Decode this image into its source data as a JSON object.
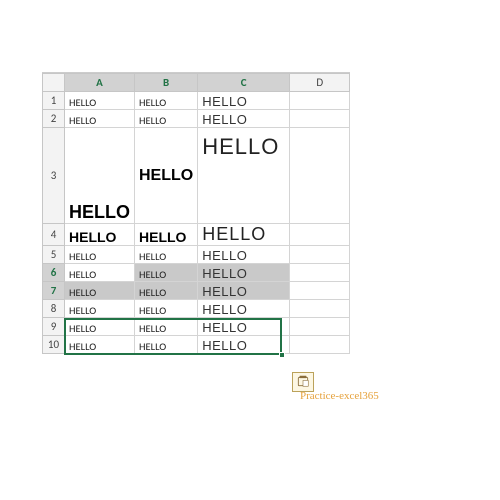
{
  "columns": [
    "A",
    "B",
    "C",
    "D"
  ],
  "rows": [
    1,
    2,
    3,
    4,
    5,
    6,
    7,
    8,
    9,
    10
  ],
  "cells": {
    "r1": {
      "A": "HELLO",
      "B": "HELLO",
      "C": "HELLO"
    },
    "r2": {
      "A": "HELLO",
      "B": "HELLO",
      "C": "HELLO"
    },
    "r3": {
      "A": "HELLO",
      "B": "HELLO",
      "C": "HELLO"
    },
    "r4": {
      "A": "HELLO",
      "B": "HELLO",
      "C": "HELLO"
    },
    "r5": {
      "A": "HELLO",
      "B": "HELLO",
      "C": "HELLO"
    },
    "r6": {
      "A": "HELLO",
      "B": "HELLO",
      "C": "HELLO"
    },
    "r7": {
      "A": "HELLO",
      "B": "HELLO",
      "C": "HELLO"
    },
    "r8": {
      "A": "HELLO",
      "B": "HELLO",
      "C": "HELLO"
    },
    "r9": {
      "A": "HELLO",
      "B": "HELLO",
      "C": "HELLO"
    },
    "r10": {
      "A": "HELLO",
      "B": "HELLO",
      "C": "HELLO"
    }
  },
  "selection": {
    "rows": [
      6,
      7
    ],
    "cols": [
      "A",
      "B",
      "C"
    ],
    "active": "A6"
  },
  "watermark": "Practice-excel365",
  "icons": {
    "paste_options": "paste-options-icon"
  }
}
